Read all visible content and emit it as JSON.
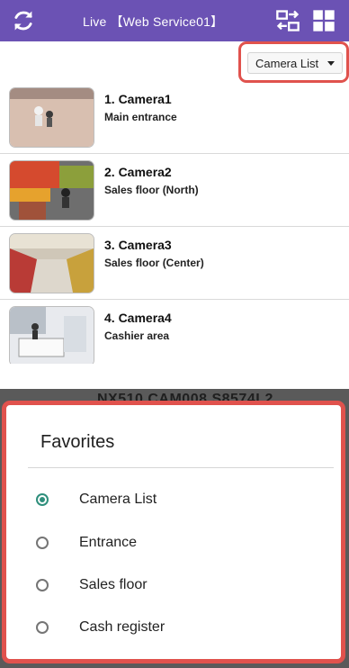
{
  "header": {
    "title": "Live 【Web Service01】",
    "bg_color": "#6b52b4",
    "icons": [
      "refresh-icon",
      "switch-user-icon",
      "grid-layout-icon"
    ]
  },
  "selector": {
    "value": "Camera List"
  },
  "cameras": [
    {
      "name": "1. Camera1",
      "location": "Main entrance"
    },
    {
      "name": "2. Camera2",
      "location": "Sales floor (North)"
    },
    {
      "name": "3. Camera3",
      "location": "Sales floor (Center)"
    },
    {
      "name": "4. Camera4",
      "location": "Cashier area"
    }
  ],
  "background": {
    "partial_text": "NX510 CAM008 S8574L2"
  },
  "favorites_dialog": {
    "title": "Favorites",
    "options": [
      {
        "label": "Camera List",
        "selected": true
      },
      {
        "label": "Entrance",
        "selected": false
      },
      {
        "label": "Sales floor",
        "selected": false
      },
      {
        "label": "Cash register",
        "selected": false
      }
    ],
    "accent_color": "#2f8f7c"
  },
  "highlight_color": "#e0524d"
}
